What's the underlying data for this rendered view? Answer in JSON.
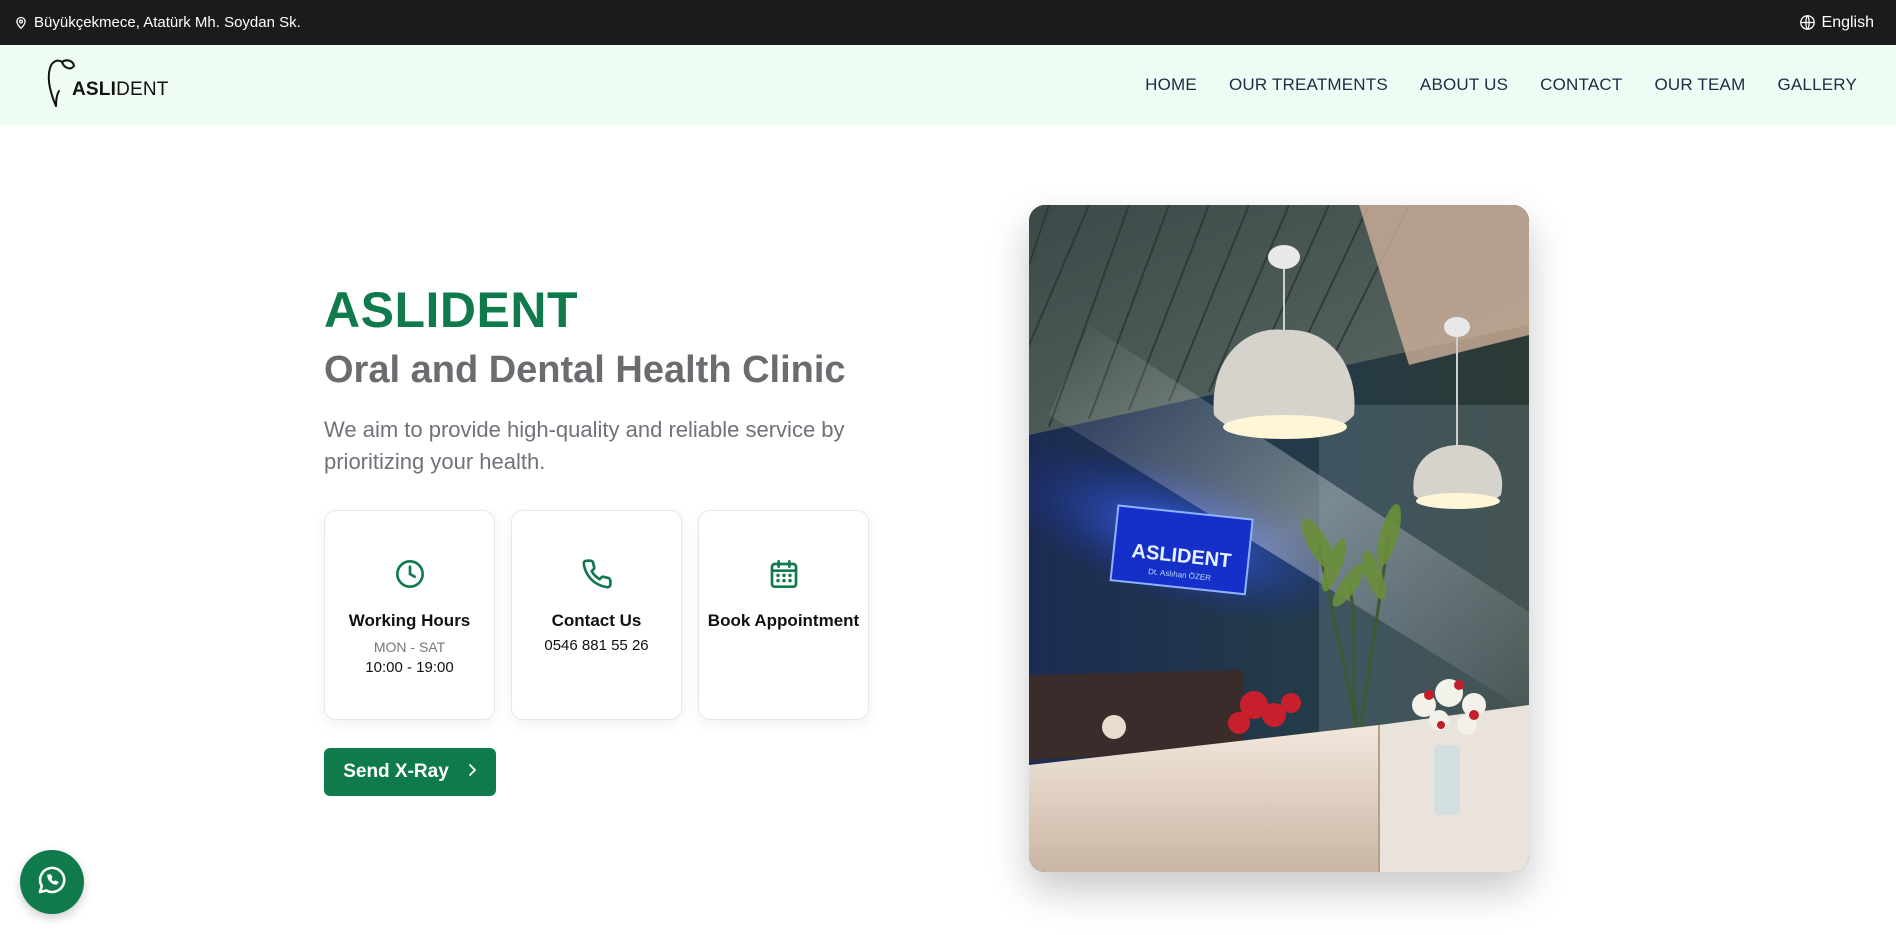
{
  "topbar": {
    "address": "Büyükçekmece, Atatürk Mh. Soydan Sk.",
    "language": "English",
    "icons": {
      "address": "map-pin-icon",
      "language": "globe-icon"
    }
  },
  "header": {
    "logo": {
      "bold": "ASLI",
      "light": "DENT",
      "icon": "tooth-icon"
    },
    "nav": [
      {
        "label": "HOME"
      },
      {
        "label": "OUR TREATMENTS"
      },
      {
        "label": "ABOUT US"
      },
      {
        "label": "CONTACT"
      },
      {
        "label": "OUR TEAM"
      },
      {
        "label": "GALLERY"
      }
    ]
  },
  "hero": {
    "title": "ASLIDENT",
    "subtitle": "Oral and Dental Health Clinic",
    "description": "We aim to provide high-quality and reliable service by prioritizing your health.",
    "cards": [
      {
        "icon": "clock-icon",
        "title": "Working Hours",
        "small": "MON - SAT",
        "value": "10:00 - 19:00"
      },
      {
        "icon": "phone-icon",
        "title": "Contact Us",
        "value": "0546 881 55 26"
      },
      {
        "icon": "calendar-icon",
        "title": "Book Appointment"
      }
    ],
    "button": {
      "label": "Send X-Ray",
      "icon": "chevron-right-icon"
    },
    "image": {
      "sign_text": "ASLIDENT",
      "sign_subtext": "Dt. Aslıhan ÖZER"
    }
  },
  "floating": {
    "whatsapp_icon": "whatsapp-icon"
  },
  "colors": {
    "brand_green": "#0f7a4b",
    "header_bg": "#effcf3",
    "topbar_bg": "#1b1b1d",
    "subtitle_gray": "#6b6b70"
  }
}
